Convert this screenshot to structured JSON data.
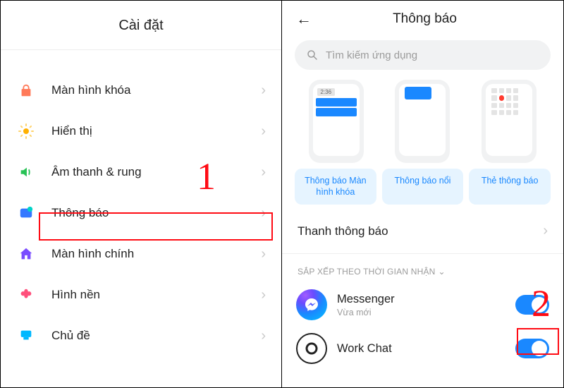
{
  "left": {
    "title": "Cài đặt",
    "items": [
      {
        "label": "Màn hình khóa"
      },
      {
        "label": "Hiển thị"
      },
      {
        "label": "Âm thanh & rung"
      },
      {
        "label": "Thông báo"
      },
      {
        "label": "Màn hình chính"
      },
      {
        "label": "Hình nền"
      },
      {
        "label": "Chủ đề"
      }
    ]
  },
  "right": {
    "title": "Thông báo",
    "search_placeholder": "Tìm kiếm ứng dụng",
    "preview_time": "2:36",
    "chips": [
      "Thông báo Màn hình khóa",
      "Thông báo nổi",
      "Thẻ thông báo"
    ],
    "section_bar": "Thanh thông báo",
    "group_label": "SẮP XẾP THEO THỜI GIAN NHẬN",
    "apps": [
      {
        "name": "Messenger",
        "sub": "Vừa mới"
      },
      {
        "name": "Work Chat",
        "sub": ""
      }
    ]
  },
  "annotations": {
    "one": "1",
    "two": "2"
  }
}
